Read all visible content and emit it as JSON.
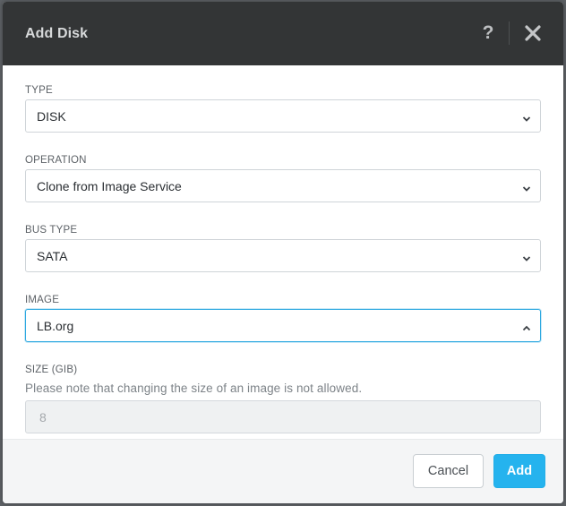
{
  "dialog": {
    "title": "Add Disk",
    "help_label": "?",
    "close_icon": "close-icon"
  },
  "fields": {
    "type": {
      "label": "TYPE",
      "value": "DISK"
    },
    "operation": {
      "label": "OPERATION",
      "value": "Clone from Image Service"
    },
    "bus_type": {
      "label": "BUS TYPE",
      "value": "SATA"
    },
    "image": {
      "label": "IMAGE",
      "value": "LB.org",
      "state": "open"
    },
    "size": {
      "label": "SIZE (GIB)",
      "note": "Please note that changing the size of an image is not allowed.",
      "value": "8"
    }
  },
  "footer": {
    "cancel_label": "Cancel",
    "add_label": "Add"
  },
  "colors": {
    "header_bg": "#333536",
    "accent": "#25b3ee",
    "focus_border": "#2da8e0"
  }
}
